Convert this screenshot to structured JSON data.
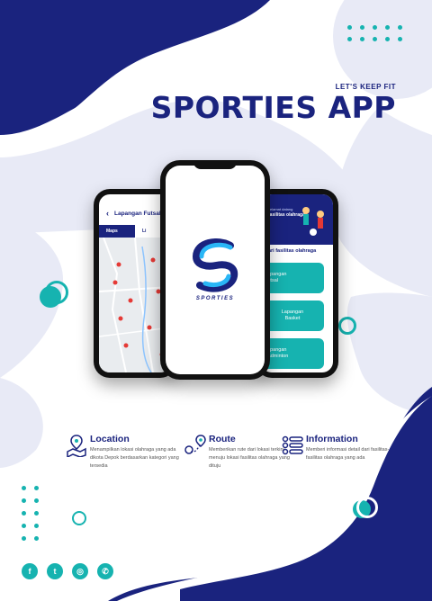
{
  "header": {
    "tagline": "LET'S KEEP FIT",
    "title": "SPORTIES APP"
  },
  "colors": {
    "navy": "#1a237e",
    "teal": "#16b3b0",
    "lavender": "#e8eaf6"
  },
  "phone_left": {
    "header_title": "Lapangan Futsal",
    "tab_active": "Maps",
    "tab_other": "Li"
  },
  "phone_center": {
    "logo_text": "SPORTIES"
  },
  "phone_right": {
    "greeting": "selamat datang",
    "subtitle": "fasilitas olahraga",
    "section_title": "Cari fasilitas olahraga",
    "cards": [
      {
        "line1": "Lapangan",
        "line2": "Futsal"
      },
      {
        "line1": "Lapangan",
        "line2": "Basket"
      },
      {
        "line1": "Lapangan",
        "line2": "Badminton"
      }
    ]
  },
  "features": [
    {
      "icon": "map-location-icon",
      "title": "Location",
      "description": "Menampilkan lokasi olahraga yang ada dikota Depok berdasarkan kategori yang tersedia"
    },
    {
      "icon": "route-icon",
      "title": "Route",
      "description": "Memberikan rute dari lokasi terkini menuju lokasi fasilitas olahraga yang dituju"
    },
    {
      "icon": "list-info-icon",
      "title": "Information",
      "description": "Memberi informasi detail dari fasilitas-fasilitas olahraga yang ada"
    }
  ],
  "social": [
    {
      "icon": "facebook-icon",
      "glyph": "f"
    },
    {
      "icon": "twitter-icon",
      "glyph": "t"
    },
    {
      "icon": "instagram-icon",
      "glyph": "◎"
    },
    {
      "icon": "whatsapp-icon",
      "glyph": "✆"
    }
  ]
}
